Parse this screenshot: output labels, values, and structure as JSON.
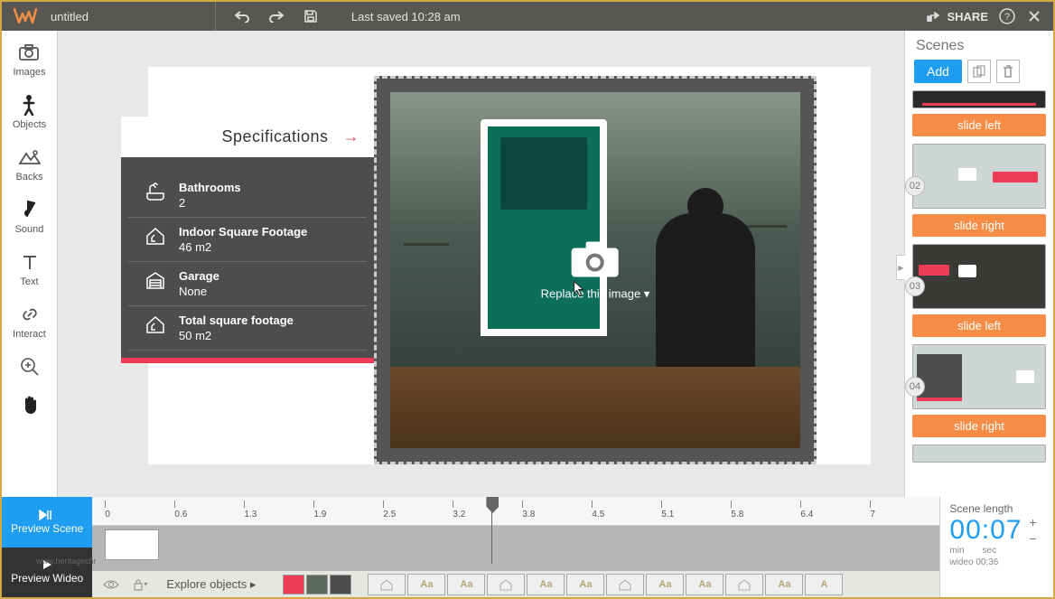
{
  "topbar": {
    "title": "untitled",
    "last_saved": "Last saved 10:28 am",
    "share": "SHARE"
  },
  "leftbar": {
    "images": "Images",
    "objects": "Objects",
    "backs": "Backs",
    "sound": "Sound",
    "text": "Text",
    "interact": "Interact"
  },
  "canvas": {
    "replace_label": "Replace this image ▾",
    "spec": {
      "title": "Specifications",
      "rows": [
        {
          "label": "Bathrooms",
          "value": "2"
        },
        {
          "label": "Indoor Square Footage",
          "value": "46 m2"
        },
        {
          "label": "Garage",
          "value": "None"
        },
        {
          "label": "Total square footage",
          "value": "50 m2"
        }
      ]
    }
  },
  "scenes": {
    "title": "Scenes",
    "add": "Add",
    "items": [
      {
        "num": "",
        "transition": "slide left"
      },
      {
        "num": "02",
        "transition": "slide right"
      },
      {
        "num": "03",
        "transition": "slide left"
      },
      {
        "num": "04",
        "transition": "slide right"
      }
    ]
  },
  "timeline": {
    "preview_scene": "Preview Scene",
    "preview_wideo": "Preview Wideo",
    "ticks": [
      "0",
      "0.6",
      "1.3",
      "1.9",
      "2.5",
      "3.2",
      "3.8",
      "4.5",
      "5.1",
      "5.8",
      "6.4",
      "7"
    ],
    "explore": "Explore objects ▸"
  },
  "scene_length": {
    "title": "Scene length",
    "time": "00:07",
    "min": "min",
    "sec": "sec",
    "total_label": "wideo 00:36"
  },
  "watermark": "www.heritagechr"
}
